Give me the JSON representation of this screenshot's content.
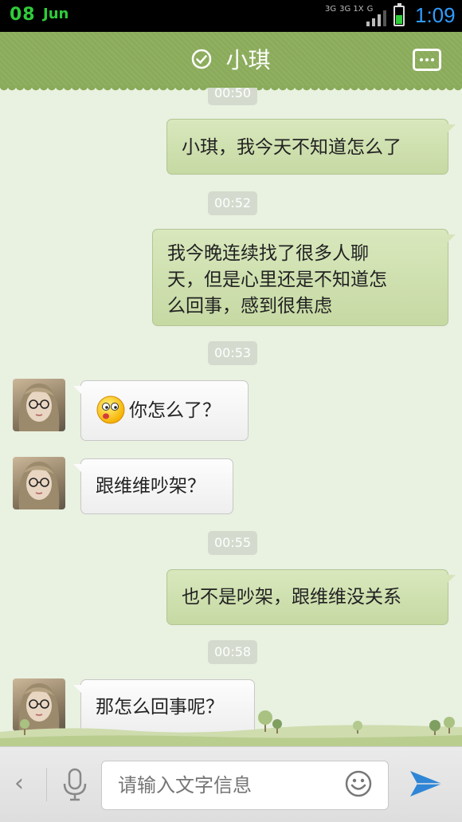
{
  "status_bar": {
    "day": "08",
    "month": "Jun",
    "network_1": "3G",
    "network_2": "3G 1X",
    "network_3": "G",
    "time": "1:09",
    "colors": {
      "clock": "#2f9cff",
      "date": "#2fcc3a"
    },
    "battery_level": 0.5
  },
  "header": {
    "title": "小琪",
    "verified_icon": "check-circle-icon",
    "menu_icon": "more-dots-icon",
    "background": "#8aab5a"
  },
  "messages": [
    {
      "type": "timestamp",
      "text": "00:50"
    },
    {
      "type": "sent",
      "text": "小琪，我今天不知道怎么了"
    },
    {
      "type": "timestamp",
      "text": "00:52"
    },
    {
      "type": "sent",
      "lines": [
        "我今晚连续找了很多人聊",
        "天，但是心里还是不知道怎",
        "么回事，感到很焦虑"
      ]
    },
    {
      "type": "timestamp",
      "text": "00:53"
    },
    {
      "type": "received",
      "emoji": "surprised-face-icon",
      "text": "你怎么了？"
    },
    {
      "type": "received",
      "text": "跟维维吵架？"
    },
    {
      "type": "timestamp",
      "text": "00:55"
    },
    {
      "type": "sent",
      "text": "也不是吵架，跟维维没关系"
    },
    {
      "type": "timestamp",
      "text": "00:58"
    },
    {
      "type": "received",
      "text": "那怎么回事呢？"
    }
  ],
  "input_bar": {
    "placeholder": "请输入文字信息",
    "back_icon": "chevron-left-icon",
    "mic_icon": "microphone-icon",
    "emoji_icon": "smiley-icon",
    "send_icon": "send-arrow-icon",
    "accent": "#2f86d6"
  }
}
